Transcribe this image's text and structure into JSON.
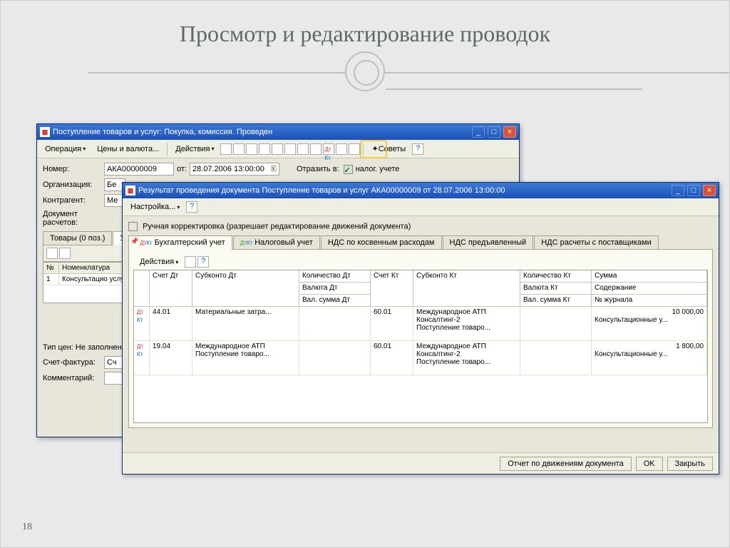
{
  "slide": {
    "title": "Просмотр и редактирование проводок",
    "page": "18"
  },
  "win1": {
    "title": "Поступление товаров и услуг: Покупка, комиссия. Проведен",
    "toolbar": {
      "op": "Операция",
      "prices": "Цены и валюта...",
      "actions": "Действия",
      "tips": "Советы"
    },
    "form": {
      "num_lbl": "Номер:",
      "num": "АКА00000009",
      "ot": "от:",
      "date": "28.07.2006 13:00:00",
      "reflect": "Отразить в:",
      "tax": "налог. учете",
      "org_lbl": "Организация:",
      "org": "Бе",
      "contr_lbl": "Контрагент:",
      "contr": "Ме",
      "doc_lbl": "Документ расчетов:"
    },
    "tabs": {
      "t1": "Товары (0 поз.)",
      "t2": "Ус"
    },
    "grid": {
      "c1": "№",
      "c2": "Номенклатура",
      "r1_c1": "1",
      "r1_c2": "Консультацио услуги"
    },
    "foot": {
      "price": "Тип цен: Не заполнен",
      "sf_lbl": "Счет-фактура:",
      "sf": "Сч",
      "com_lbl": "Комментарий:"
    }
  },
  "win2": {
    "title": "Результат проведения документа Поступление товаров и услуг АКА00000009 от 28.07.2006 13:00:00",
    "settings": "Настройка...",
    "manual": "Ручная корректировка (разрешает редактирование движений документа)",
    "tabs": {
      "t1": "Бухгалтерский учет",
      "t2": "Налоговый учет",
      "t3": "НДС по косвенным расходам",
      "t4": "НДС предъявленный",
      "t5": "НДС расчеты с поставщиками"
    },
    "actions": "Действия",
    "headers": {
      "acc_dt": "Счет Дт",
      "sub_dt": "Субконто Дт",
      "qty_dt": "Количество Дт",
      "cur_dt": "Валюта Дт",
      "valsum_dt": "Вал. сумма Дт",
      "acc_kt": "Счет Кт",
      "sub_kt": "Субконто Кт",
      "qty_kt": "Количество Кт",
      "cur_kt": "Валюта Кт",
      "valsum_kt": "Вал. сумма Кт",
      "sum": "Сумма",
      "content": "Содержание",
      "journal": "№ журнала"
    },
    "rows": [
      {
        "acc_dt": "44.01",
        "sub_dt": "Материальные затра...",
        "acc_kt": "60.01",
        "sub_kt_1": "Международное АТП",
        "sub_kt_2": "Консалтинг-2",
        "sub_kt_3": "Поступление товаро...",
        "sum": "10 000,00",
        "content": "Консультационные у..."
      },
      {
        "acc_dt": "19.04",
        "sub_dt_1": "Международное АТП",
        "sub_dt_2": "Поступление товаро...",
        "acc_kt": "60.01",
        "sub_kt_1": "Международное АТП",
        "sub_kt_2": "Консалтинг-2",
        "sub_kt_3": "Поступление товаро...",
        "sum": "1 800,00",
        "content": "Консультационные у..."
      }
    ],
    "footer": {
      "report": "Отчет по движениям документа",
      "ok": "OK",
      "close": "Закрыть"
    }
  }
}
